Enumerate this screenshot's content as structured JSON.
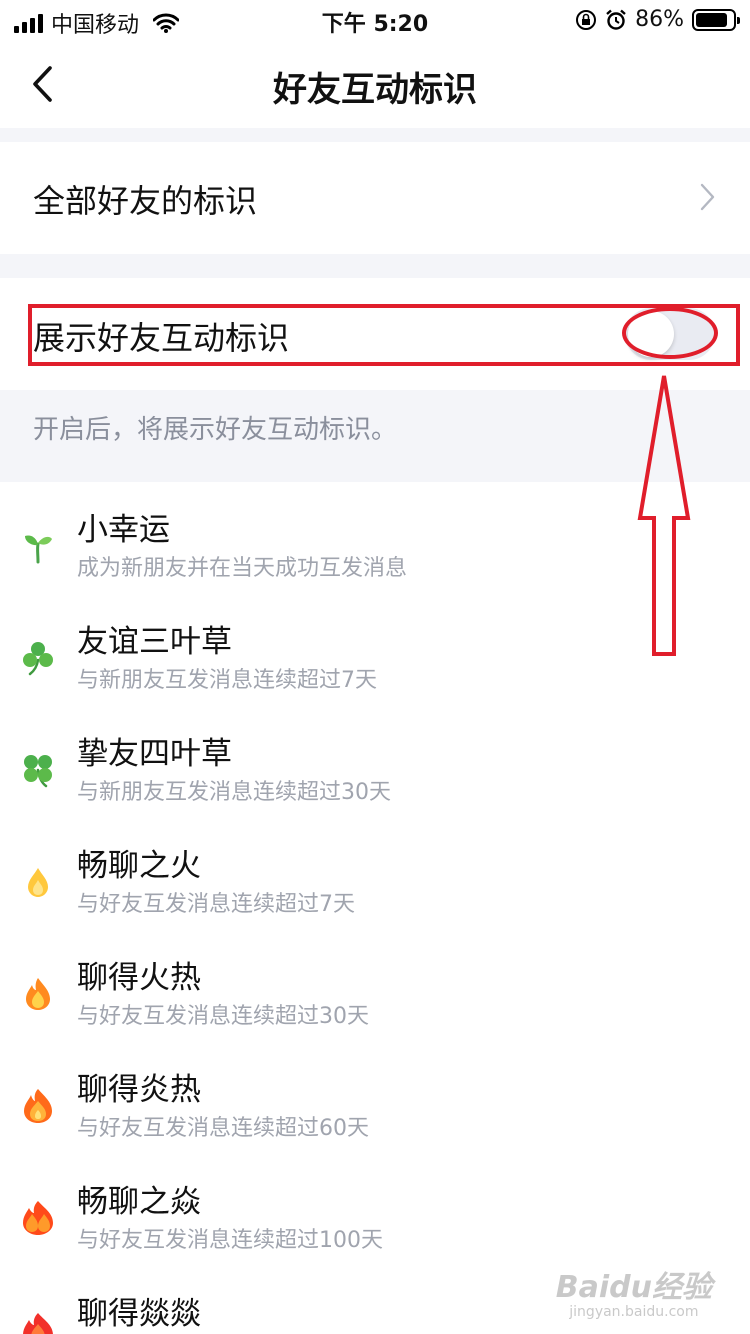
{
  "status_bar": {
    "carrier": "中国移动",
    "time": "下午 5:20",
    "battery_pct": "86%",
    "battery_level": 0.86
  },
  "nav": {
    "title": "好友互动标识"
  },
  "settings": {
    "all_friends_label": "全部好友的标识",
    "show_toggle_label": "展示好友互动标识",
    "show_toggle_on": false,
    "hint": "开启后，将展示好友互动标识。"
  },
  "badges": [
    {
      "name": "小幸运",
      "desc": "成为新朋友并在当天成功互发消息",
      "icon": "sprout-icon"
    },
    {
      "name": "友谊三叶草",
      "desc": "与新朋友互发消息连续超过7天",
      "icon": "three-leaf-clover-icon"
    },
    {
      "name": "挚友四叶草",
      "desc": "与新朋友互发消息连续超过30天",
      "icon": "four-leaf-clover-icon"
    },
    {
      "name": "畅聊之火",
      "desc": "与好友互发消息连续超过7天",
      "icon": "small-flame-icon"
    },
    {
      "name": "聊得火热",
      "desc": "与好友互发消息连续超过30天",
      "icon": "flame-icon"
    },
    {
      "name": "聊得炎热",
      "desc": "与好友互发消息连续超过60天",
      "icon": "big-flame-icon"
    },
    {
      "name": "畅聊之焱",
      "desc": "与好友互发消息连续超过100天",
      "icon": "double-flame-icon"
    },
    {
      "name": "聊得燚燚",
      "desc": "",
      "icon": "quad-flame-icon"
    }
  ],
  "colors": {
    "annotation_red": "#e01e2b",
    "section_gap": "#f4f5f9",
    "secondary_text": "#a0a4ae"
  },
  "watermark": {
    "main": "Baidu经验",
    "sub": "jingyan.baidu.com"
  }
}
